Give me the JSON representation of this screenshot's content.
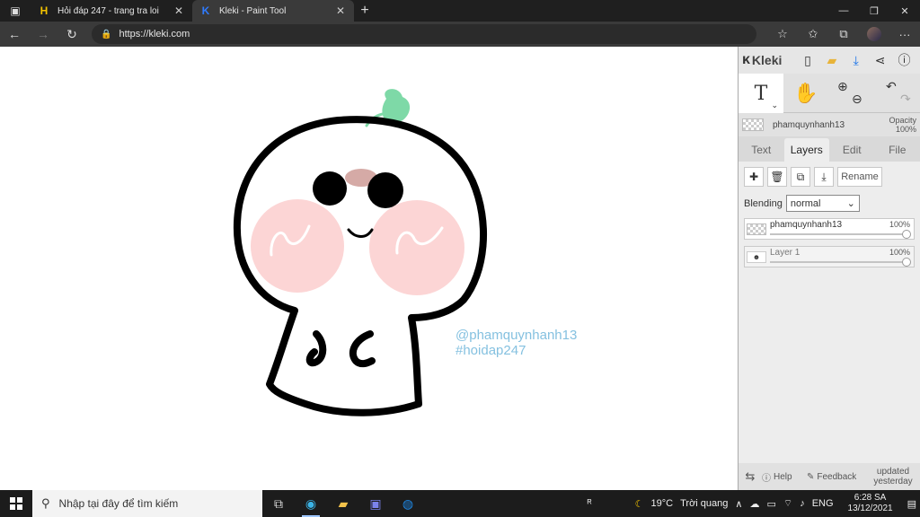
{
  "browser": {
    "tabs": [
      {
        "title": "Hỏi đáp 247 - trang tra loi",
        "favicon": "H",
        "favicon_color": "#f5c400",
        "active": false
      },
      {
        "title": "Kleki - Paint Tool",
        "favicon": "K",
        "favicon_color": "#2f7bff",
        "active": true
      }
    ],
    "url": "https://kleki.com"
  },
  "canvas": {
    "watermark_line1": "@phamquynhanh13",
    "watermark_line2": "#hoidap247",
    "colors": {
      "line": "#000000",
      "blush": "#fcd5d5",
      "sprout": "#7ed9a7",
      "forehead": "#d5aaa6"
    }
  },
  "panel": {
    "brand": "Kleki",
    "current_layer_name": "phamquynhanh13",
    "opacity_label": "Opacity",
    "opacity_value": "100%",
    "tabs": [
      {
        "label": "Text",
        "active": false
      },
      {
        "label": "Layers",
        "active": true
      },
      {
        "label": "Edit",
        "active": false
      },
      {
        "label": "File",
        "active": false
      }
    ],
    "rename_label": "Rename",
    "blending_label": "Blending",
    "blending_value": "normal",
    "layers": [
      {
        "name": "phamquynhanh13",
        "opacity": "100%"
      },
      {
        "name": "Layer 1",
        "opacity": "100%"
      }
    ],
    "footer": {
      "help": "Help",
      "feedback": "Feedback",
      "updated_line1": "updated",
      "updated_line2": "yesterday"
    }
  },
  "taskbar": {
    "search_placeholder": "Nhập tại đây để tìm kiếm",
    "weather_temp": "19°C",
    "weather_text": "Trời quang",
    "language": "ENG",
    "time": "6:28 SA",
    "date": "13/12/2021"
  }
}
